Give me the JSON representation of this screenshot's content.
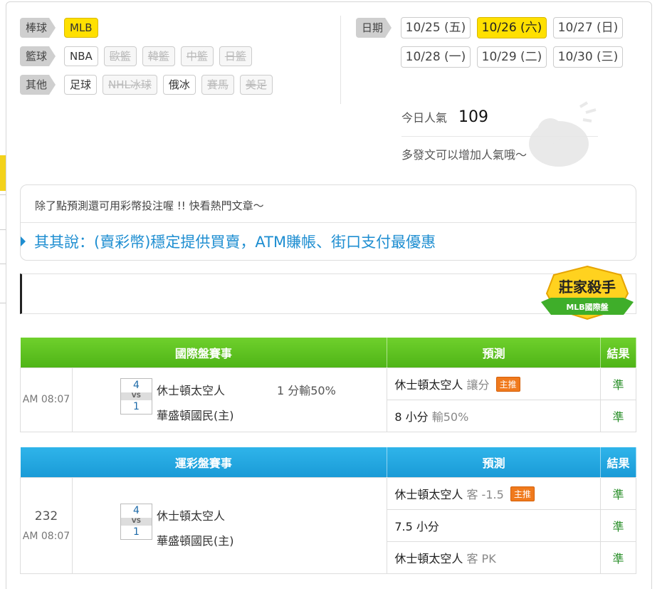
{
  "categories": [
    {
      "label": "棒球",
      "items": [
        {
          "text": "MLB",
          "state": "active"
        }
      ]
    },
    {
      "label": "籃球",
      "items": [
        {
          "text": "NBA",
          "state": "normal"
        },
        {
          "text": "歐籃",
          "state": "disabled"
        },
        {
          "text": "韓籃",
          "state": "disabled"
        },
        {
          "text": "中籃",
          "state": "disabled"
        },
        {
          "text": "日籃",
          "state": "disabled"
        }
      ]
    },
    {
      "label": "其他",
      "items": [
        {
          "text": "足球",
          "state": "normal"
        },
        {
          "text": "NHL冰球",
          "state": "disabled"
        },
        {
          "text": "俄冰",
          "state": "normal"
        },
        {
          "text": "賽馬",
          "state": "disabled"
        },
        {
          "text": "美足",
          "state": "disabled"
        }
      ]
    }
  ],
  "dates": {
    "label": "日期",
    "items": [
      {
        "text": "10/25 (五)",
        "active": false
      },
      {
        "text": "10/26 (六)",
        "active": true
      },
      {
        "text": "10/27 (日)",
        "active": false
      },
      {
        "text": "10/28 (一)",
        "active": false
      },
      {
        "text": "10/29 (二)",
        "active": false
      },
      {
        "text": "10/30 (三)",
        "active": false
      }
    ]
  },
  "popularity": {
    "label": "今日人氣",
    "value": "109",
    "hint": "多發文可以增加人氣哦～"
  },
  "notice": {
    "text": "除了點預測還可用彩幣投注喔 !! 快看熱門文章～",
    "link": "其其說：(賣彩幣)穩定提供買賣，ATM賺帳、街口支付最優惠"
  },
  "badge": {
    "title": "莊家殺手",
    "subtitle": "MLB國際盤"
  },
  "intl": {
    "headers": [
      "國際盤賽事",
      "預測",
      "結果"
    ],
    "time": "AM 08:07",
    "away_score": "4",
    "home_score": "1",
    "vs": "VS",
    "away_team": "休士頓太空人",
    "home_team": "華盛頓國民(主)",
    "line": "1 分輸50%",
    "preds": [
      {
        "main": "休士頓太空人",
        "sub": "讓分",
        "tag": "主推",
        "result": "準"
      },
      {
        "main": "8 小分",
        "sub": "輸50%",
        "tag": "",
        "result": "準"
      }
    ]
  },
  "sport": {
    "headers": [
      "運彩盤賽事",
      "預測",
      "結果"
    ],
    "num": "232",
    "time": "AM 08:07",
    "away_score": "4",
    "home_score": "1",
    "vs": "VS",
    "away_team": "休士頓太空人",
    "home_team": "華盛頓國民(主)",
    "preds": [
      {
        "main": "休士頓太空人",
        "sub": "客 -1.5",
        "tag": "主推",
        "result": "準"
      },
      {
        "main": "7.5 小分",
        "sub": "",
        "tag": "",
        "result": "準"
      },
      {
        "main": "休士頓太空人",
        "sub": "客 PK",
        "tag": "",
        "result": "準"
      }
    ]
  }
}
